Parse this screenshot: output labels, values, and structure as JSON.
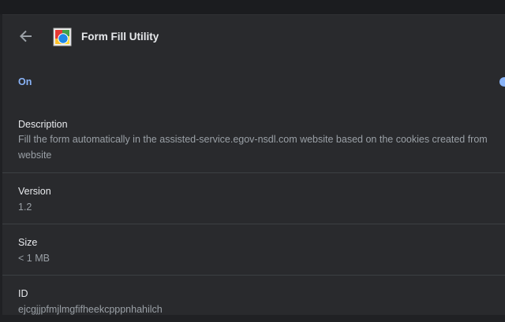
{
  "extension": {
    "title": "Form Fill Utility"
  },
  "toggle": {
    "label": "On",
    "state": "on"
  },
  "description": {
    "label": "Description",
    "line1": "Fill the form automatically in the assisted-service.egov-nsdl.com website based on the cookies created from",
    "line2": "website"
  },
  "version": {
    "label": "Version",
    "value": "1.2"
  },
  "size": {
    "label": "Size",
    "value": "< 1 MB"
  },
  "id": {
    "label": "ID",
    "value": "ejcgjjpfmjlmgfifheekcpppnhahilch"
  },
  "colors": {
    "background": "#292a2d",
    "accent": "#8ab4f8",
    "text_primary": "#e8eaed",
    "text_secondary": "#9aa0a6"
  },
  "icons": {
    "back": "arrow-back-icon",
    "extension": "extension-logo-icon"
  }
}
